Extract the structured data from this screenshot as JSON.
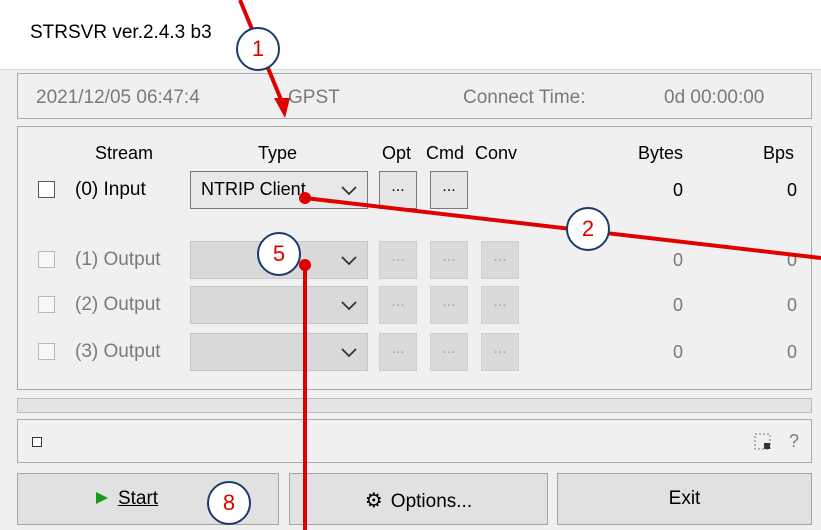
{
  "window": {
    "title": "STRSVR ver.2.4.3 b3"
  },
  "status": {
    "datetime": "2021/12/05 06:47:4",
    "time_system": "GPST",
    "connect_label": "Connect Time:",
    "connect_value": "0d 00:00:00"
  },
  "table": {
    "headers": {
      "stream": "Stream",
      "type": "Type",
      "opt": "Opt",
      "cmd": "Cmd",
      "conv": "Conv",
      "bytes": "Bytes",
      "bps": "Bps"
    },
    "input": {
      "label": "(0) Input",
      "type": "NTRIP Client",
      "opt": "...",
      "cmd": "...",
      "bytes": "0",
      "bps": "0"
    },
    "outputs": [
      {
        "label": "(1) Output",
        "type": "",
        "btn": "...",
        "bytes": "0",
        "bps": "0"
      },
      {
        "label": "(2) Output",
        "type": "",
        "btn": "...",
        "bytes": "0",
        "bps": "0"
      },
      {
        "label": "(3) Output",
        "type": "",
        "btn": "...",
        "bytes": "0",
        "bps": "0"
      }
    ]
  },
  "bottom_status": {
    "help": "?"
  },
  "buttons": {
    "start": "Start",
    "options": "Options...",
    "exit": "Exit"
  },
  "callouts": [
    "1",
    "2",
    "5",
    "8"
  ],
  "colors": {
    "callout": "#e00000",
    "start_arrow": "#1a9a1a"
  }
}
